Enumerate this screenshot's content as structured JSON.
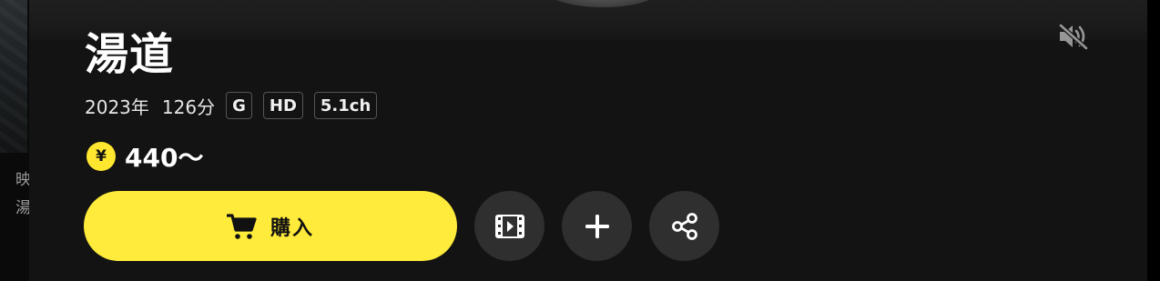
{
  "side": {
    "text_line1": "映",
    "text_line2": "湯"
  },
  "movie": {
    "title": "湯道",
    "year": "2023年",
    "duration": "126分",
    "badges": [
      "G",
      "HD",
      "5.1ch"
    ]
  },
  "price": {
    "currency_symbol": "¥",
    "amount": "440〜"
  },
  "actions": {
    "buy_label": "購入",
    "icons": {
      "buy": "cart-icon",
      "trailer": "film-icon",
      "add": "plus-icon",
      "share": "share-icon",
      "mute": "volume-muted-icon"
    }
  },
  "colors": {
    "accent": "#ffeb3b",
    "panel": "#131313",
    "circle_button": "#2f2f2f"
  }
}
